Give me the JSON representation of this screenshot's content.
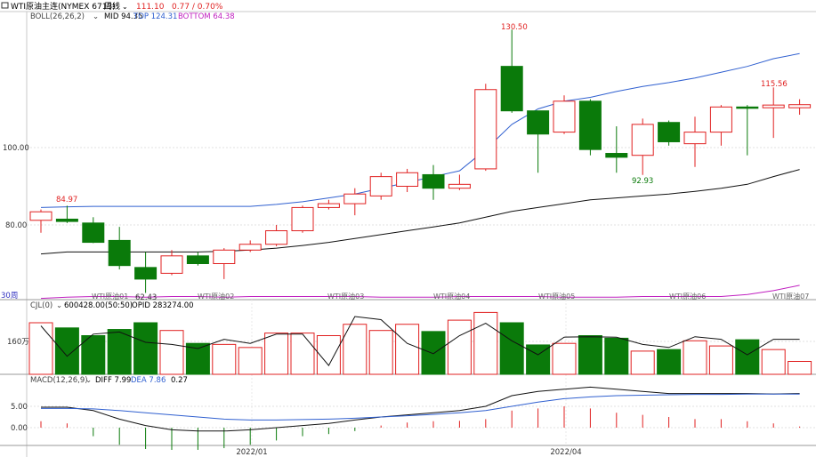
{
  "header": {
    "symbol": "WTI原油主连(NYMEX 6713)",
    "period": "周线",
    "price": "111.10",
    "change": "0.77 / 0.70%",
    "colors": {
      "up": "#e02020",
      "down": "#0a7a0a"
    }
  },
  "boll": {
    "label": "BOLL(26,26,2)",
    "mid": "MID 94.35",
    "top": "TOP 124.31",
    "bottom": "BOTTOM 64.38"
  },
  "cjl": {
    "label": "CJL(0)",
    "vol": "600428.00(50:50)",
    "opid": "OPID 283274.00",
    "axis_label": "160万"
  },
  "macd": {
    "label": "MACD(12,26,9)",
    "diff": "DIFF 7.99",
    "dea": "DEA 7.86",
    "macd": "0.27",
    "ticks": [
      "5.00",
      "0.00"
    ]
  },
  "markers": {
    "period_label": "30周"
  },
  "x_axis": {
    "labels": [
      "2022/01",
      "2022/04"
    ]
  },
  "chart_data": {
    "type": "candlestick",
    "y_ticks": [
      "100.00",
      "80.00"
    ],
    "annotations": [
      "84.97",
      "62.43",
      "130.50",
      "92.93",
      "115.56"
    ],
    "contract_labels": [
      "WTI原油01",
      "WTI原油02",
      "WTI原油03",
      "WTI原油04",
      "WTI原油05",
      "WTI原油06",
      "WTI原油07"
    ],
    "candles": [
      {
        "o": 81.2,
        "c": 83.4,
        "h": 84.0,
        "l": 78.0
      },
      {
        "o": 81.5,
        "c": 80.9,
        "h": 84.97,
        "l": 80.5
      },
      {
        "o": 80.5,
        "c": 75.5,
        "h": 82.0,
        "l": 75.3
      },
      {
        "o": 76.0,
        "c": 69.5,
        "h": 79.5,
        "l": 68.5
      },
      {
        "o": 69.0,
        "c": 66.0,
        "h": 73.0,
        "l": 62.43
      },
      {
        "o": 67.5,
        "c": 72.0,
        "h": 73.5,
        "l": 67.0
      },
      {
        "o": 72.0,
        "c": 70.0,
        "h": 73.0,
        "l": 69.5
      },
      {
        "o": 70.0,
        "c": 73.5,
        "h": 74.0,
        "l": 66.0
      },
      {
        "o": 73.5,
        "c": 75.0,
        "h": 76.0,
        "l": 73.0
      },
      {
        "o": 75.0,
        "c": 78.5,
        "h": 80.0,
        "l": 74.5
      },
      {
        "o": 78.5,
        "c": 84.5,
        "h": 85.0,
        "l": 78.0
      },
      {
        "o": 84.5,
        "c": 85.5,
        "h": 86.5,
        "l": 84.0
      },
      {
        "o": 85.5,
        "c": 88.0,
        "h": 89.5,
        "l": 82.5
      },
      {
        "o": 87.5,
        "c": 92.5,
        "h": 93.5,
        "l": 86.5
      },
      {
        "o": 90.0,
        "c": 93.5,
        "h": 94.5,
        "l": 88.5
      },
      {
        "o": 93.0,
        "c": 89.5,
        "h": 95.5,
        "l": 86.5
      },
      {
        "o": 89.5,
        "c": 90.5,
        "h": 93.0,
        "l": 89.0
      },
      {
        "o": 94.5,
        "c": 115.0,
        "h": 116.5,
        "l": 94.0
      },
      {
        "o": 121.0,
        "c": 109.5,
        "h": 130.5,
        "l": 109.0
      },
      {
        "o": 109.5,
        "c": 103.5,
        "h": 109.5,
        "l": 93.5
      },
      {
        "o": 104.0,
        "c": 112.0,
        "h": 113.5,
        "l": 103.5
      },
      {
        "o": 112.0,
        "c": 99.5,
        "h": 112.5,
        "l": 98.0
      },
      {
        "o": 98.5,
        "c": 97.5,
        "h": 105.5,
        "l": 93.5
      },
      {
        "o": 98.0,
        "c": 106.0,
        "h": 107.5,
        "l": 92.93
      },
      {
        "o": 106.5,
        "c": 101.5,
        "h": 107.0,
        "l": 100.5
      },
      {
        "o": 101.0,
        "c": 104.0,
        "h": 108.0,
        "l": 95.0
      },
      {
        "o": 104.0,
        "c": 110.5,
        "h": 111.0,
        "l": 100.5
      },
      {
        "o": 110.5,
        "c": 110.2,
        "h": 111.0,
        "l": 98.0
      },
      {
        "o": 110.3,
        "c": 111.0,
        "h": 115.56,
        "l": 102.5
      },
      {
        "o": 110.3,
        "c": 111.1,
        "h": 112.5,
        "l": 108.5
      }
    ],
    "boll_top": [
      84.5,
      84.7,
      84.8,
      84.8,
      84.8,
      84.8,
      84.8,
      84.8,
      84.8,
      85.3,
      86.0,
      87.0,
      88.0,
      89.5,
      91.0,
      92.5,
      94.0,
      99.5,
      106.0,
      110.0,
      112.0,
      113.0,
      114.5,
      115.8,
      116.8,
      118.0,
      119.5,
      121.0,
      123.0,
      124.31
    ],
    "boll_mid": [
      72.5,
      73.0,
      73.0,
      73.0,
      73.0,
      73.0,
      73.0,
      73.2,
      73.5,
      74.0,
      74.7,
      75.5,
      76.5,
      77.5,
      78.5,
      79.5,
      80.5,
      82.0,
      83.5,
      84.5,
      85.5,
      86.5,
      87.0,
      87.5,
      88.0,
      88.7,
      89.5,
      90.5,
      92.5,
      94.35
    ],
    "boll_bottom": [
      61.0,
      61.3,
      61.5,
      61.5,
      61.3,
      61.5,
      61.5,
      61.3,
      61.5,
      61.5,
      61.5,
      61.5,
      61.5,
      61.3,
      61.3,
      61.3,
      61.5,
      61.5,
      61.5,
      61.5,
      61.3,
      61.3,
      61.3,
      61.5,
      61.5,
      61.5,
      61.5,
      62.0,
      63.0,
      64.38
    ],
    "volume": [
      1.0,
      0.9,
      0.75,
      0.87,
      1.0,
      0.85,
      0.6,
      0.58,
      0.52,
      0.8,
      0.8,
      0.75,
      0.97,
      0.85,
      0.97,
      0.83,
      1.05,
      1.2,
      1.0,
      0.57,
      0.6,
      0.75,
      0.7,
      0.45,
      0.48,
      0.65,
      0.55,
      0.67,
      0.48,
      0.25
    ],
    "open_interest": [
      0.94,
      0.35,
      0.78,
      0.82,
      0.62,
      0.58,
      0.5,
      0.68,
      0.6,
      0.78,
      0.78,
      0.17,
      1.12,
      1.06,
      0.6,
      0.4,
      0.75,
      0.99,
      0.65,
      0.38,
      0.72,
      0.73,
      0.72,
      0.58,
      0.52,
      0.73,
      0.68,
      0.38,
      0.68,
      0.68
    ],
    "macd_hist": [
      1.5,
      1.0,
      -2.0,
      -4.0,
      -5.0,
      -5.2,
      -5.2,
      -4.8,
      -4.0,
      -3.0,
      -2.0,
      -1.5,
      -0.8,
      0.5,
      1.2,
      1.5,
      1.6,
      2.0,
      4.0,
      4.5,
      5.0,
      4.5,
      3.5,
      3.0,
      2.5,
      2.0,
      2.0,
      1.5,
      1.0,
      0.27
    ],
    "macd_diff": [
      4.8,
      4.8,
      4.0,
      2.0,
      0.5,
      -0.5,
      -0.8,
      -0.8,
      -0.5,
      0.0,
      0.5,
      1.0,
      1.8,
      2.5,
      3.0,
      3.5,
      4.0,
      5.0,
      7.5,
      8.5,
      9.0,
      9.5,
      9.0,
      8.5,
      8.0,
      8.0,
      8.0,
      8.0,
      7.9,
      7.99
    ],
    "macd_dea": [
      4.5,
      4.5,
      4.4,
      4.0,
      3.5,
      3.0,
      2.5,
      2.0,
      1.8,
      1.8,
      1.9,
      2.0,
      2.2,
      2.5,
      2.8,
      3.1,
      3.5,
      4.0,
      5.0,
      6.0,
      6.8,
      7.2,
      7.5,
      7.6,
      7.7,
      7.8,
      7.8,
      7.85,
      7.86,
      7.86
    ]
  }
}
